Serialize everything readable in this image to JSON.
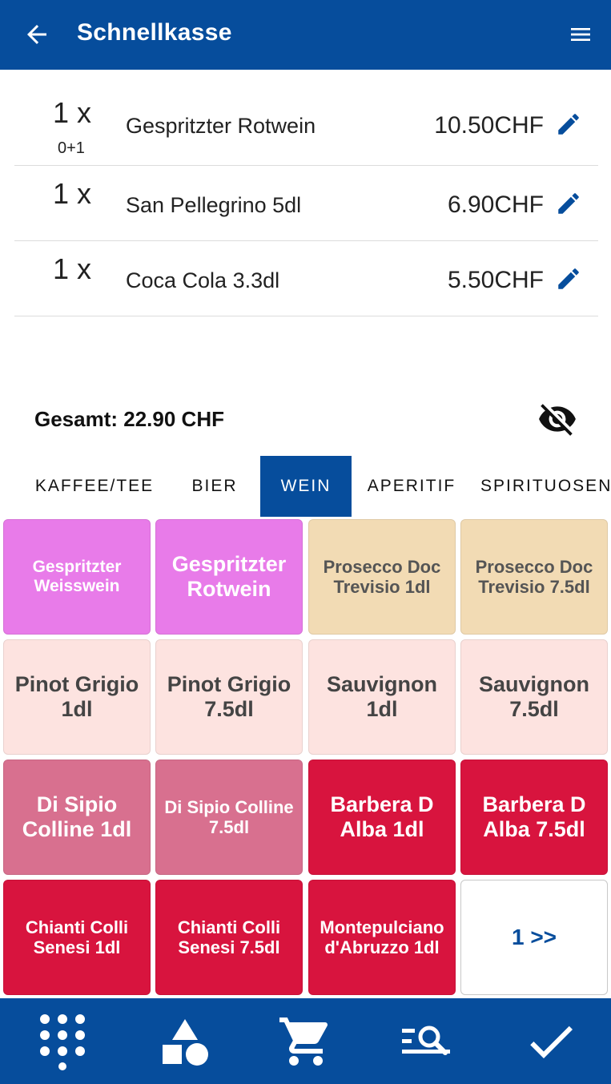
{
  "appbar": {
    "title": "Schnellkasse"
  },
  "orders": [
    {
      "qty": "1 x",
      "sub": "0+1",
      "name": "Gespritzter Rotwein",
      "price": "10.50CHF"
    },
    {
      "qty": "1 x",
      "sub": "",
      "name": "San Pellegrino 5dl",
      "price": "6.90CHF"
    },
    {
      "qty": "1 x",
      "sub": "",
      "name": "Coca Cola 3.3dl",
      "price": "5.50CHF"
    }
  ],
  "total": "Gesamt: 22.90 CHF",
  "tabs": [
    "KAFFEE/TEE",
    "BIER",
    "WEIN",
    "APERITIF",
    "SPIRITUOSEN"
  ],
  "active_tab": "WEIN",
  "products": [
    {
      "label": "Gespritzter Weisswein",
      "color": "#e87be9"
    },
    {
      "label": "Gespritzter Rotwein",
      "color": "#e87be9"
    },
    {
      "label": "Prosecco Doc Trevisio 1dl",
      "color": "#f2dbb4"
    },
    {
      "label": "Prosecco Doc Trevisio 7.5dl",
      "color": "#f2dbb4"
    },
    {
      "label": "Pinot Grigio 1dl",
      "color": "#fde3e0"
    },
    {
      "label": "Pinot Grigio 7.5dl",
      "color": "#fde3e0"
    },
    {
      "label": "Sauvignon 1dl",
      "color": "#fde3e0"
    },
    {
      "label": "Sauvignon 7.5dl",
      "color": "#fde3e0"
    },
    {
      "label": "Di Sipio Colline 1dl",
      "color": "#d8708f"
    },
    {
      "label": "Di Sipio Colline 7.5dl",
      "color": "#d8708f"
    },
    {
      "label": "Barbera D Alba 1dl",
      "color": "#d8143e"
    },
    {
      "label": "Barbera D Alba 7.5dl",
      "color": "#d8143e"
    },
    {
      "label": "Chianti Colli Senesi 1dl",
      "color": "#d8143e"
    },
    {
      "label": "Chianti Colli Senesi 7.5dl",
      "color": "#d8143e"
    },
    {
      "label": "Montepulciano d'Abruzzo 1dl",
      "color": "#d8143e"
    }
  ],
  "pager": {
    "label": "1 >>"
  },
  "bottom_nav": [
    "keypad-icon",
    "shapes-icon",
    "cart-icon",
    "search-list-icon",
    "check-icon"
  ],
  "colors": {
    "primary": "#064d9c"
  }
}
